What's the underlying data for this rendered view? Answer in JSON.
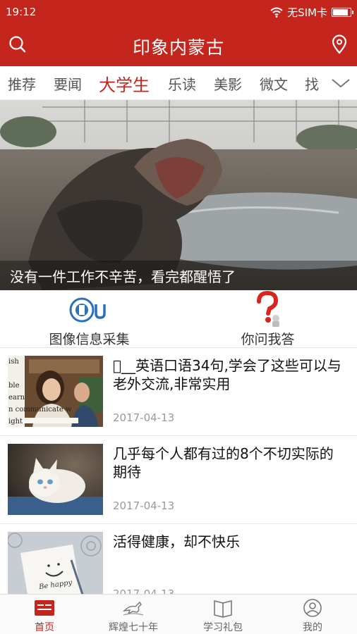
{
  "status_bar": {
    "time": "19:12",
    "carrier": "无SIM卡",
    "battery_level": 0.9,
    "icons": [
      "wifi-icon",
      "battery-icon"
    ]
  },
  "header": {
    "title": "印象内蒙古",
    "left_icon": "search-icon",
    "right_icon": "location-pin-icon"
  },
  "tabs": {
    "items": [
      {
        "label": "推荐"
      },
      {
        "label": "要闻"
      },
      {
        "label": "大学生",
        "active": true
      },
      {
        "label": "乐读"
      },
      {
        "label": "美影"
      },
      {
        "label": "微文"
      },
      {
        "label": "找"
      }
    ],
    "more_icon": "chevron-down-icon"
  },
  "banner": {
    "caption": "没有一件工作不辛苦，看完都醒悟了"
  },
  "quick_links": [
    {
      "label": "图像信息采集",
      "icon": "info-collection-logo-icon"
    },
    {
      "label": "你问我答",
      "icon": "question-mark-icon"
    }
  ],
  "news": [
    {
      "title": "\u0000__英语口语34句,学会了这些可以与老外交流,非常实用",
      "date": "2017-04-13",
      "thumb_text": [
        "ish",
        "ble",
        "earn",
        "n communicate w",
        "ight"
      ]
    },
    {
      "title": "几乎每个人都有过的8个不切实际的期待",
      "date": "2017-04-13"
    },
    {
      "title": "活得健康，却不快乐",
      "date": "2017-04-13",
      "thumb_text": [
        "Be happy"
      ]
    }
  ],
  "bottom_nav": {
    "items": [
      {
        "label": "首页",
        "icon": "home-icon",
        "active": true
      },
      {
        "label": "辉煌七十年",
        "icon": "horse-icon"
      },
      {
        "label": "学习礼包",
        "icon": "book-icon"
      },
      {
        "label": "我的",
        "icon": "user-icon"
      }
    ]
  },
  "colors": {
    "brand_red": "#c4261d",
    "tab_text": "#555555",
    "date_text": "#999999"
  }
}
